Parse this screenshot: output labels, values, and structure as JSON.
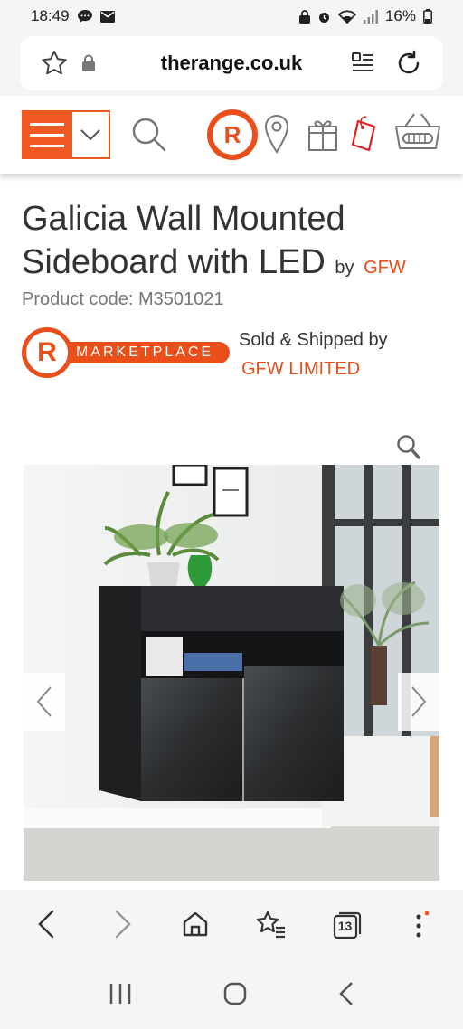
{
  "status_bar": {
    "time": "18:49",
    "battery": "16%"
  },
  "browser": {
    "url": "therange.co.uk",
    "tab_count": "13"
  },
  "breadcrumb": "Galicia Wall Mounted Sideboard with LED",
  "product": {
    "title": "Galicia Wall Mounted Sideboard with LED",
    "by_label": "by",
    "brand": "GFW",
    "code_label": "Product code: M3501021"
  },
  "marketplace": {
    "logo_letter": "R",
    "logo_text": "MARKETPLACE",
    "sold_label": "Sold & Shipped by",
    "seller": "GFW LIMITED"
  },
  "colors": {
    "brand": "#e94e1b",
    "menu": "#f05a22"
  },
  "icons": [
    "star-icon",
    "lock-icon",
    "reader-icon",
    "reload-icon",
    "menu-icon",
    "chevron-down-icon",
    "search-icon",
    "range-logo-icon",
    "location-pin-icon",
    "gift-icon",
    "tag-icon",
    "basket-icon",
    "zoom-icon",
    "chevron-left-icon",
    "chevron-right-icon",
    "back-icon",
    "forward-icon",
    "home-icon",
    "bookmarks-icon",
    "tabs-icon",
    "more-icon",
    "recents-icon",
    "home-circle-icon"
  ]
}
